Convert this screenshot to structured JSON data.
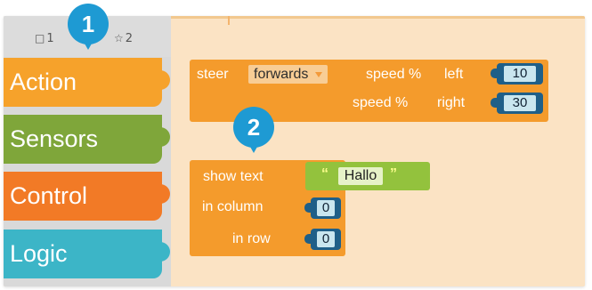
{
  "tabs": [
    {
      "icon": "□",
      "label": "1"
    },
    {
      "icon": "☆",
      "label": "2"
    }
  ],
  "categories": [
    {
      "label": "Action",
      "color": "#f6a22b"
    },
    {
      "label": "Sensors",
      "color": "#7fa63a"
    },
    {
      "label": "Control",
      "color": "#f27a26"
    },
    {
      "label": "Logic",
      "color": "#3cb5c7"
    }
  ],
  "steer_block": {
    "keyword": "steer",
    "direction": "forwards",
    "speed_label_left": "speed %",
    "side_left": "left",
    "left_value": "10",
    "speed_label_right": "speed %",
    "side_right": "right",
    "right_value": "30"
  },
  "show_text_block": {
    "keyword": "show text",
    "text_value": "Hallo",
    "open_quote": "“",
    "close_quote": "”",
    "column_label": "in column",
    "column_value": "0",
    "row_label": "in row",
    "row_value": "0"
  },
  "callouts": {
    "one": "1",
    "two": "2"
  }
}
